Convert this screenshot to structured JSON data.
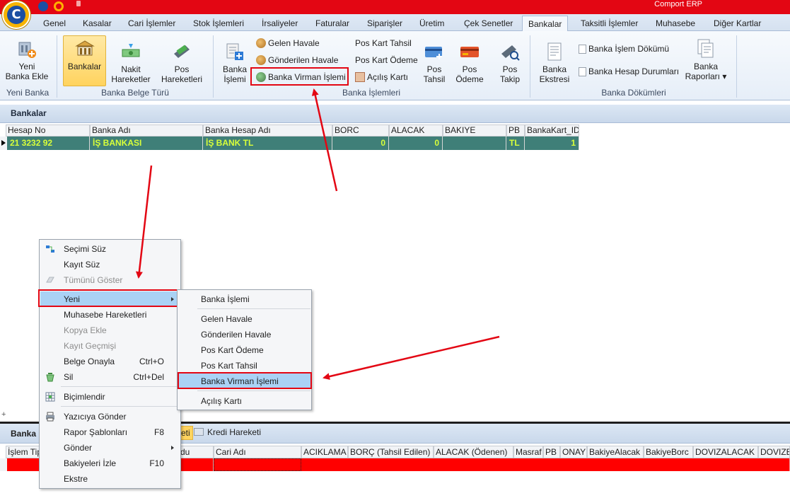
{
  "app": {
    "title": "Comport ERP",
    "logo_letter": "C",
    "brand_red": "#e30613"
  },
  "tabs": [
    {
      "label": "Genel"
    },
    {
      "label": "Kasalar"
    },
    {
      "label": "Cari İşlemler"
    },
    {
      "label": "Stok İşlemleri"
    },
    {
      "label": "İrsaliyeler"
    },
    {
      "label": "Faturalar"
    },
    {
      "label": "Siparişler"
    },
    {
      "label": "Üretim"
    },
    {
      "label": "Çek Senetler"
    },
    {
      "label": "Bankalar",
      "active": true
    },
    {
      "label": "Taksitli İşlemler"
    },
    {
      "label": "Muhasebe"
    },
    {
      "label": "Diğer Kartlar"
    }
  ],
  "ribbon": {
    "yeni_banka": {
      "button": "Yeni\nBanka Ekle",
      "group": "Yeni Banka"
    },
    "belge_turu": {
      "group": "Banka Belge Türü",
      "bankalar": "Bankalar",
      "nakit": "Nakit\nHareketler",
      "pos": "Pos\nHareketleri"
    },
    "islemler": {
      "group": "Banka İşlemleri",
      "banka_islemi": "Banka\nİşlemi",
      "gelen_havale": "Gelen Havale",
      "gonderilen_havale": "Gönderilen Havale",
      "banka_virman": "Banka Virman İşlemi",
      "pos_kart_tahsil": "Pos Kart Tahsil",
      "pos_kart_odeme": "Pos Kart Ödeme",
      "acilis_karti": "Açılış Kartı",
      "pos_tahsil": "Pos\nTahsil",
      "pos_odeme": "Pos\nÖdeme",
      "pos_takip": "Pos\nTakip"
    },
    "dokumler": {
      "group": "Banka Dökümleri",
      "ekstre": "Banka\nEkstresi",
      "islem_dokumu": "Banka İşlem Dökümü",
      "hesap_durumlari": "Banka Hesap Durumları",
      "raporlari": "Banka\nRaporları ▾"
    }
  },
  "panel": {
    "title": "Bankalar",
    "columns": [
      "Hesap No",
      "Banka Adı",
      "Banka Hesap Adı",
      "BORC",
      "ALACAK",
      "BAKIYE",
      "PB",
      "BankaKart_ID"
    ],
    "rows": [
      {
        "hesap_no": "21 3232 92",
        "banka_adi": "İŞ BANKASI",
        "hesap_adi": "İŞ BANK TL",
        "borc": "0",
        "alacak": "0",
        "bakiye": "",
        "pb": "TL",
        "id": "1"
      }
    ],
    "row_color": "#3f7f78",
    "row_text_color": "#d8ff3a"
  },
  "context_menu": {
    "items": [
      {
        "label": "Seçimi Süz",
        "shortcut": ""
      },
      {
        "label": "Kayıt Süz",
        "shortcut": ""
      },
      {
        "label": "Tümünü Göster",
        "shortcut": ""
      },
      {
        "label": "Yeni",
        "shortcut": ""
      },
      {
        "label": "Muhasebe Hareketleri",
        "shortcut": ""
      },
      {
        "label": "Kopya Ekle",
        "shortcut": ""
      },
      {
        "label": "Kayıt Geçmişi",
        "shortcut": ""
      },
      {
        "label": "Belge Onayla",
        "shortcut": "Ctrl+O"
      },
      {
        "label": "Sil",
        "shortcut": "Ctrl+Del"
      },
      {
        "label": "Biçimlendir",
        "shortcut": ""
      },
      {
        "label": "Yazıcıya Gönder",
        "shortcut": ""
      },
      {
        "label": "Rapor Şablonları",
        "shortcut": "F8"
      },
      {
        "label": "Gönder",
        "shortcut": ""
      },
      {
        "label": "Bakiyeleri İzle",
        "shortcut": "F10"
      },
      {
        "label": "Ekstre",
        "shortcut": ""
      }
    ],
    "submenu": [
      {
        "label": "Banka İşlemi"
      },
      {
        "label": "Gelen Havale"
      },
      {
        "label": "Gönderilen Havale"
      },
      {
        "label": "Pos Kart Ödeme"
      },
      {
        "label": "Pos Kart Tahsil"
      },
      {
        "label": "Banka Virman İşlemi"
      },
      {
        "label": "Açılış Kartı"
      }
    ],
    "highlight_color": "#aad2f5"
  },
  "bottom": {
    "title_fragment": "Banka",
    "tab_fragment": "eti",
    "kredi_tab": "Kredi Hareketi",
    "columns": [
      "İşlem Tipi",
      "du",
      "Cari Adı",
      "ACIKLAMA",
      "BORÇ (Tahsil Edilen)",
      "ALACAK (Ödenen)",
      "Masraf",
      "PB",
      "ONAY",
      "BakiyeAlacak",
      "BakiyeBorc",
      "DOVIZALACAK",
      "DOVIZB"
    ],
    "row_color": "#ff0000"
  },
  "annotations": {
    "color": "#e30613"
  }
}
